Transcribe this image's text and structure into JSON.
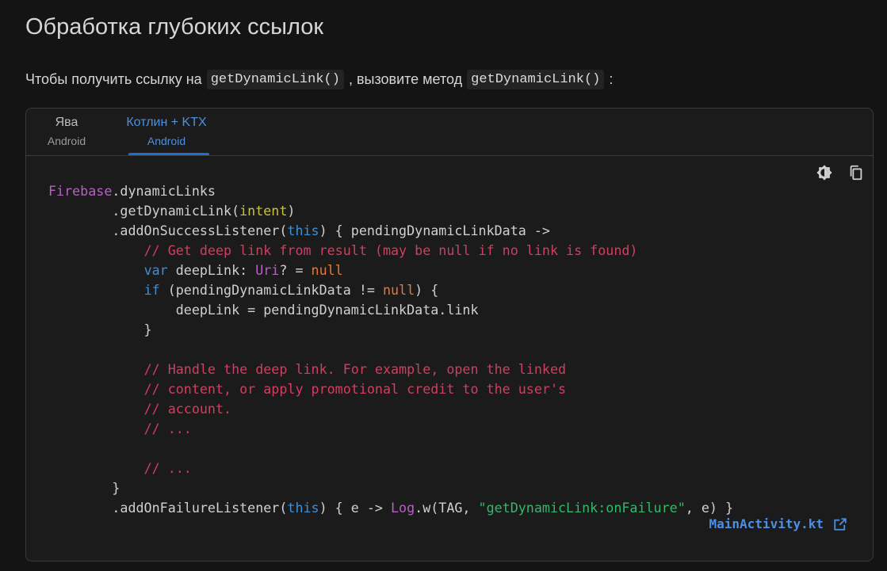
{
  "page": {
    "title": "Обработка глубоких ссылок",
    "intro": {
      "before": "Чтобы получить ссылку на",
      "code1": "getDynamicLink()",
      "middle": ", вызовите метод",
      "code2": "getDynamicLink()",
      "after": ":"
    }
  },
  "tabs": [
    {
      "label": "Ява",
      "sublabel": "Android",
      "active": false
    },
    {
      "label": "Котлин + KTX",
      "sublabel": "Android",
      "active": true
    }
  ],
  "toolbar": {
    "icons": [
      "theme-toggle-icon",
      "copy-icon"
    ]
  },
  "code": {
    "lines": [
      [
        {
          "t": "Firebase",
          "c": "class"
        },
        {
          "t": ".dynamicLinks"
        }
      ],
      [
        {
          "t": "        .getDynamicLink("
        },
        {
          "t": "intent",
          "c": "param"
        },
        {
          "t": ")"
        }
      ],
      [
        {
          "t": "        .addOnSuccessListener("
        },
        {
          "t": "this",
          "c": "kw"
        },
        {
          "t": ") { pendingDynamicLinkData ->"
        }
      ],
      [
        {
          "t": "            "
        },
        {
          "t": "// Get deep link from result (may be null if no link is found)",
          "c": "comment"
        }
      ],
      [
        {
          "t": "            "
        },
        {
          "t": "var",
          "c": "kw"
        },
        {
          "t": " deepLink: "
        },
        {
          "t": "Uri",
          "c": "class"
        },
        {
          "t": "? = "
        },
        {
          "t": "null",
          "c": "null"
        }
      ],
      [
        {
          "t": "            "
        },
        {
          "t": "if",
          "c": "kw"
        },
        {
          "t": " (pendingDynamicLinkData != "
        },
        {
          "t": "null",
          "c": "null"
        },
        {
          "t": ") {"
        }
      ],
      [
        {
          "t": "                deepLink = pendingDynamicLinkData.link"
        }
      ],
      [
        {
          "t": "            }"
        }
      ],
      [
        {
          "t": ""
        }
      ],
      [
        {
          "t": "            "
        },
        {
          "t": "// Handle the deep link. For example, open the linked",
          "c": "comment"
        }
      ],
      [
        {
          "t": "            "
        },
        {
          "t": "// content, or apply promotional credit to the user's",
          "c": "comment"
        }
      ],
      [
        {
          "t": "            "
        },
        {
          "t": "// account.",
          "c": "comment"
        }
      ],
      [
        {
          "t": "            "
        },
        {
          "t": "// ...",
          "c": "comment"
        }
      ],
      [
        {
          "t": ""
        }
      ],
      [
        {
          "t": "            "
        },
        {
          "t": "// ...",
          "c": "comment"
        }
      ],
      [
        {
          "t": "        }"
        }
      ],
      [
        {
          "t": "        .addOnFailureListener("
        },
        {
          "t": "this",
          "c": "kw"
        },
        {
          "t": ") { e -> "
        },
        {
          "t": "Log",
          "c": "class"
        },
        {
          "t": ".w(TAG, "
        },
        {
          "t": "\"getDynamicLink:onFailure\"",
          "c": "str"
        },
        {
          "t": ", e) }"
        }
      ]
    ],
    "source_file": "MainActivity.kt"
  },
  "colors": {
    "background": "#141414",
    "code_background": "#1b1b1b",
    "accent": "#4d8fe0",
    "comment": "#d23d62",
    "keyword": "#3f8fd6",
    "class": "#b860c6",
    "string": "#33b86b",
    "null": "#e07a3e",
    "param": "#c9c23e"
  }
}
